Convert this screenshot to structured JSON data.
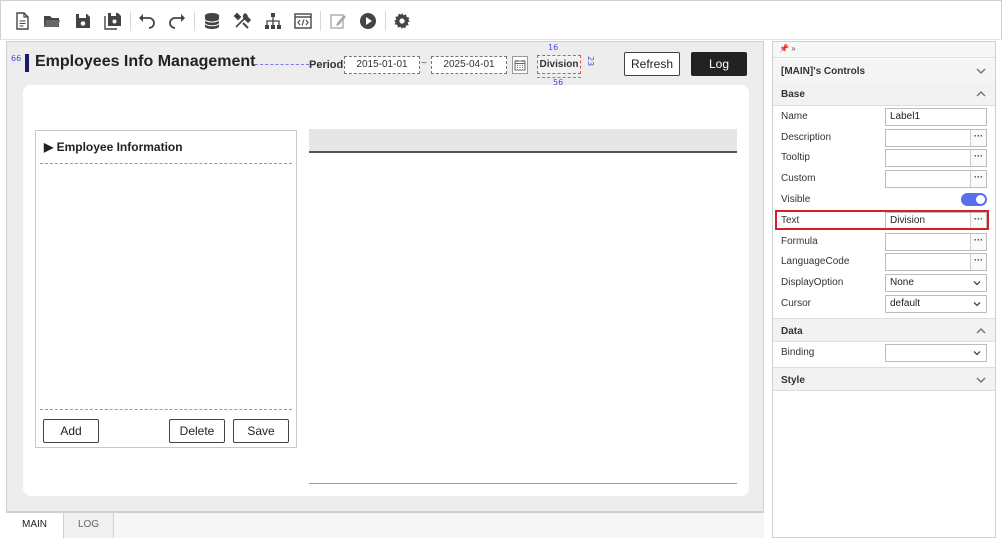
{
  "toolbar": {
    "icons": [
      "new-file-icon",
      "open-folder-icon",
      "save-icon",
      "save-all-icon",
      "undo-icon",
      "redo-icon",
      "database-icon",
      "tools-icon",
      "hierarchy-icon",
      "code-icon",
      "edit-icon",
      "run-icon",
      "settings-icon"
    ]
  },
  "design": {
    "page_title": "Employees Info Management",
    "period_label": "Period",
    "date_from": "2015-01-01",
    "tilde": "~",
    "date_to": "2025-04-01",
    "division_label": "Division",
    "refresh_label": "Refresh",
    "log_label": "Log",
    "dim_left": "66",
    "dim_top": "16",
    "dim_right": "23",
    "dim_bottom": "56"
  },
  "employee_panel": {
    "title": "Employee Information",
    "add_label": "Add",
    "delete_label": "Delete",
    "save_label": "Save"
  },
  "tabs": [
    {
      "label": "MAIN",
      "active": true
    },
    {
      "label": "LOG",
      "active": false
    }
  ],
  "properties": {
    "pin_arrows": "» ",
    "controls_header": "[MAIN]'s Controls",
    "sections": {
      "base": "Base",
      "data": "Data",
      "style": "Style"
    },
    "rows": {
      "name": {
        "label": "Name",
        "value": "Label1"
      },
      "description": {
        "label": "Description",
        "value": ""
      },
      "tooltip": {
        "label": "Tooltip",
        "value": ""
      },
      "custom": {
        "label": "Custom",
        "value": ""
      },
      "visible": {
        "label": "Visible",
        "value": true
      },
      "text": {
        "label": "Text",
        "value": "Division"
      },
      "formula": {
        "label": "Formula",
        "value": ""
      },
      "language_code": {
        "label": "LanguageCode",
        "value": ""
      },
      "display_option": {
        "label": "DisplayOption",
        "value": "None"
      },
      "cursor": {
        "label": "Cursor",
        "value": "default"
      },
      "binding": {
        "label": "Binding",
        "value": ""
      }
    },
    "dots": "···"
  },
  "colors": {
    "accent_toggle": "#5a6ff0",
    "highlight": "#d81f26",
    "log_button": "#222222"
  }
}
